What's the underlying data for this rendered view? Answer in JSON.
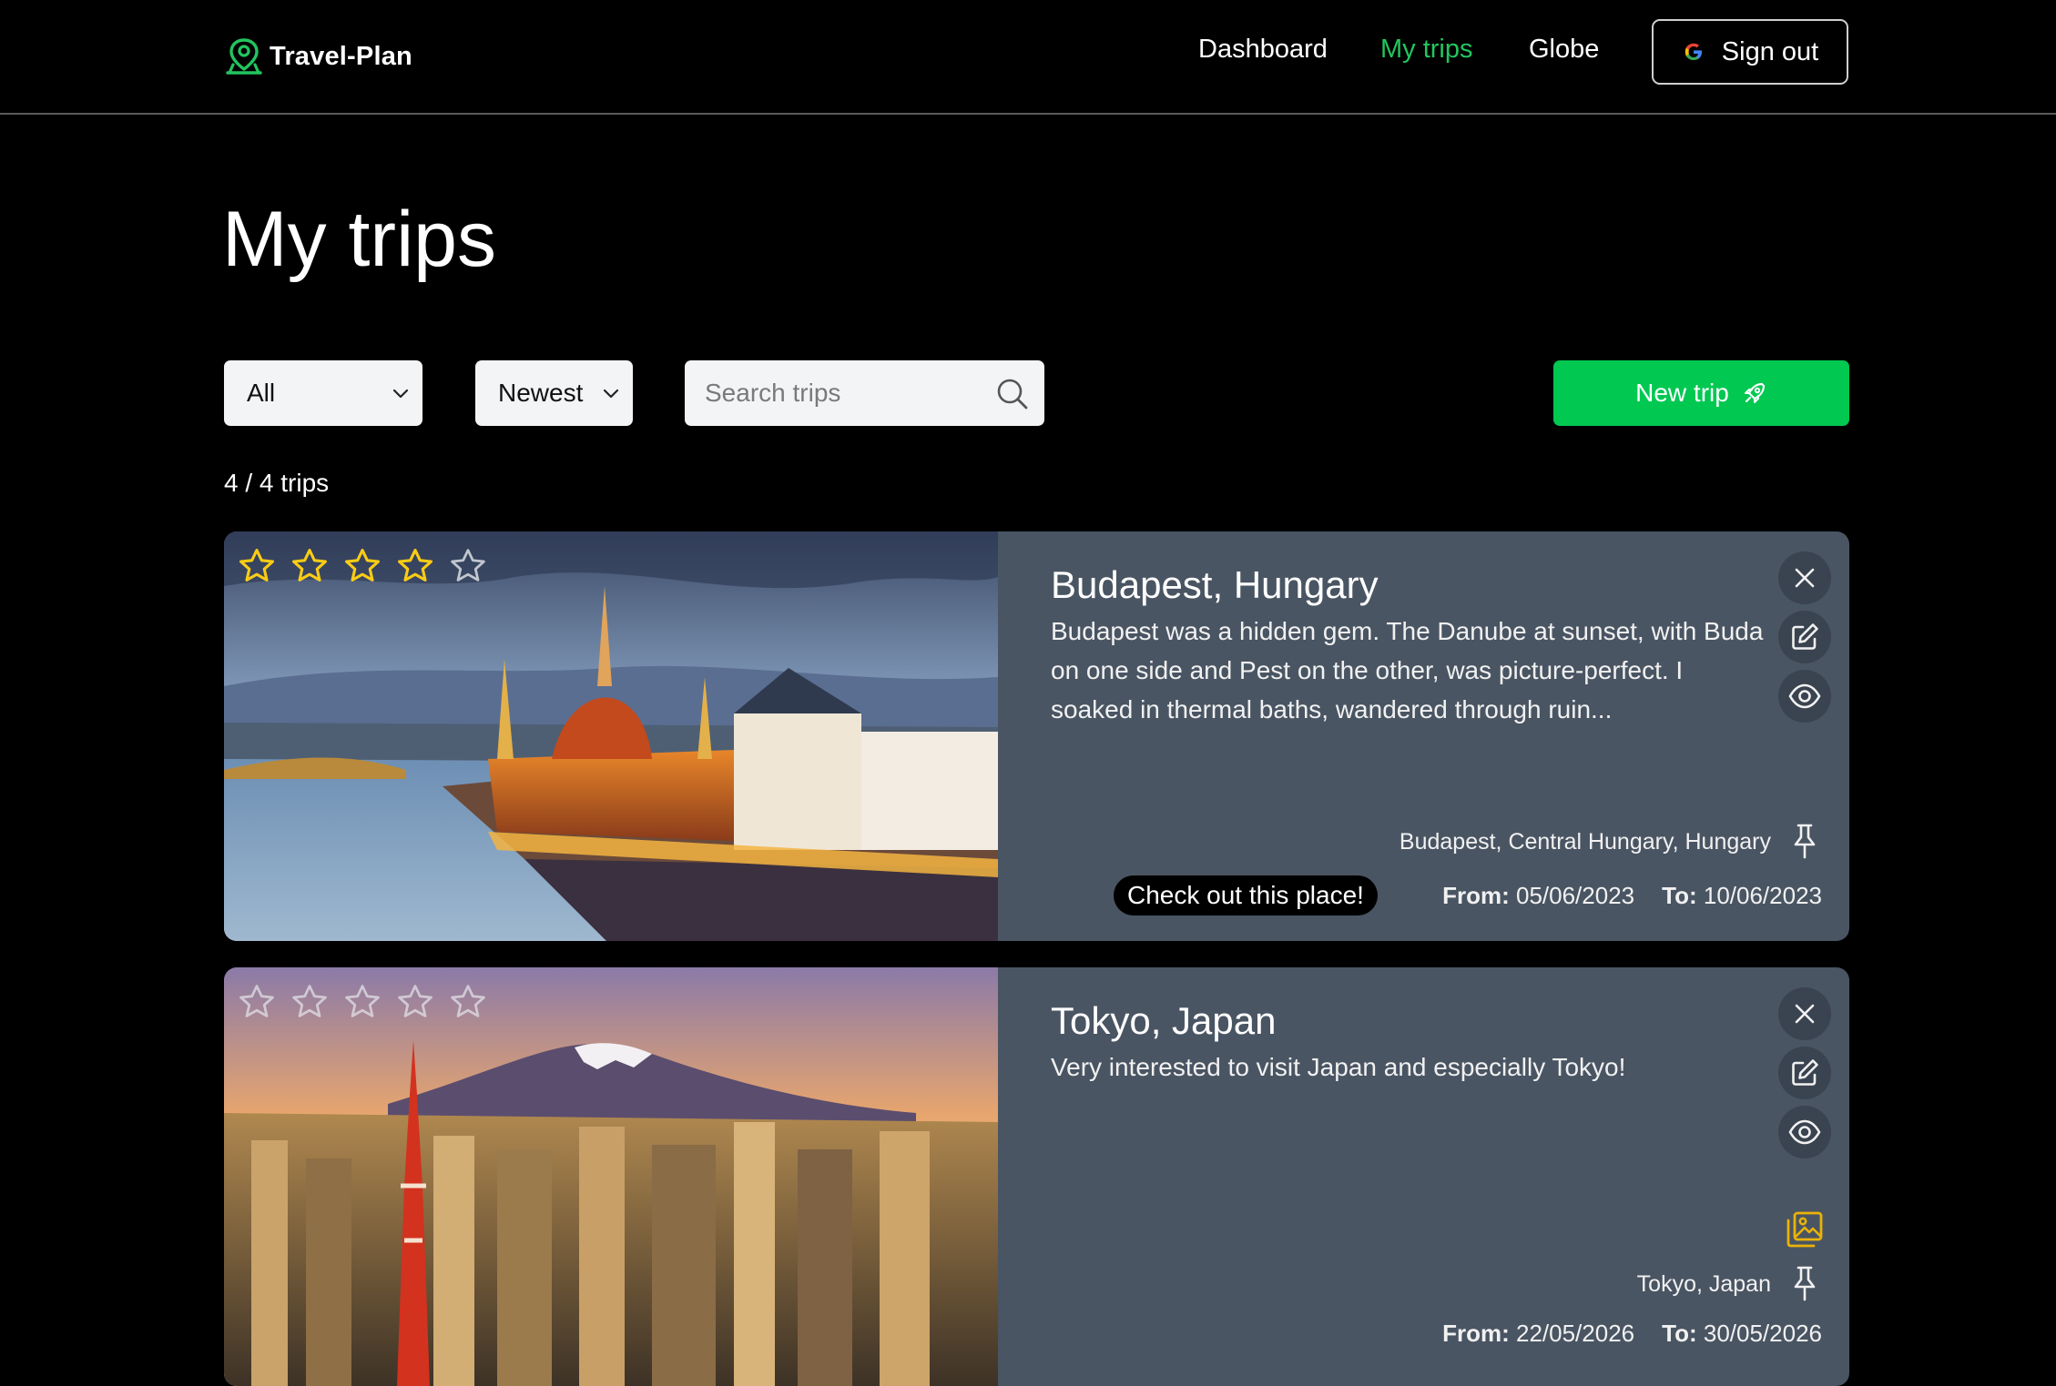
{
  "app": {
    "brand": "Travel-Plan"
  },
  "nav": {
    "dashboard": "Dashboard",
    "my_trips": "My trips",
    "globe": "Globe",
    "sign_out": "Sign out"
  },
  "colors": {
    "accent": "#22c55e",
    "new_trip_bg": "#00c851",
    "card_bg": "#4a5563",
    "star_filled": "#facc15"
  },
  "page": {
    "title": "My trips"
  },
  "filters": {
    "category": {
      "selected": "All"
    },
    "sort": {
      "selected": "Newest"
    },
    "search": {
      "placeholder": "Search trips",
      "value": ""
    }
  },
  "actions": {
    "new_trip": "New trip"
  },
  "summary": {
    "count": "4 / 4 trips"
  },
  "trips": [
    {
      "title": "Budapest, Hungary",
      "description": "Budapest was a hidden gem. The Danube at sunset, with Buda on one side and Pest on the other, was picture-perfect. I soaked in thermal baths, wandered through ruin...",
      "rating": 4,
      "rating_max": 5,
      "location": "Budapest, Central Hungary, Hungary",
      "badge": "Check out this place!",
      "from_label": "From:",
      "from": "05/06/2023",
      "to_label": "To:",
      "to": "10/06/2023",
      "icons": [
        "close-icon",
        "edit-icon",
        "eye-icon",
        "pin-icon"
      ]
    },
    {
      "title": "Tokyo, Japan",
      "description": "Very interested to visit Japan and especially Tokyo!",
      "rating": 0,
      "rating_max": 5,
      "location": "Tokyo, Japan",
      "from_label": "From:",
      "from": "22/05/2026",
      "to_label": "To:",
      "to": "30/05/2026",
      "icons": [
        "close-icon",
        "edit-icon",
        "eye-icon",
        "gallery-icon",
        "pin-icon"
      ]
    }
  ]
}
